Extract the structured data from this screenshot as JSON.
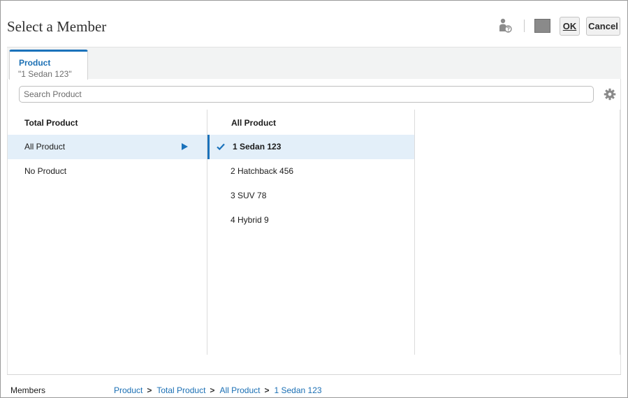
{
  "dialog": {
    "title": "Select a Member",
    "ok_label": "OK",
    "cancel_label": "Cancel",
    "icons": [
      "member-info-icon",
      "display-mode-icon"
    ]
  },
  "tab": {
    "label": "Product",
    "value": "\"1 Sedan 123\""
  },
  "search": {
    "placeholder": "Search Product"
  },
  "columns": [
    {
      "header": "Total Product",
      "items": [
        "All Product",
        "No Product"
      ],
      "selected": "All Product"
    },
    {
      "header": "All Product",
      "items": [
        "1 Sedan 123",
        "2 Hatchback 456",
        "3 SUV 78",
        "4 Hybrid 9"
      ],
      "selected": "1 Sedan 123"
    }
  ],
  "footer": {
    "label": "Members",
    "breadcrumb": [
      "Product",
      "Total Product",
      "All Product",
      "1 Sedan 123"
    ]
  },
  "colors": {
    "accent": "#1a72bb",
    "selected_row": "#e3eff9"
  }
}
